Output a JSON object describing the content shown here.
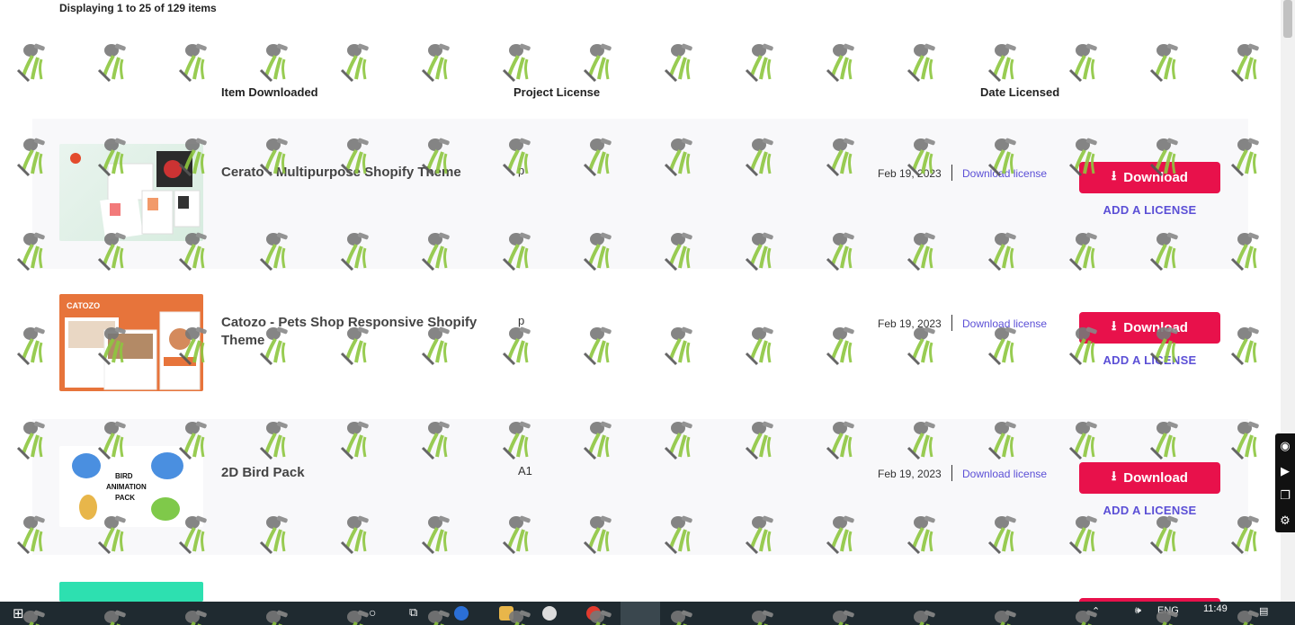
{
  "summary": "Displaying 1 to 25 of 129 items",
  "columns": {
    "item": "Item Downloaded",
    "license": "Project License",
    "date": "Date Licensed"
  },
  "rows": [
    {
      "title": "Cerato - Multipurpose Shopify Theme",
      "license": "p",
      "date": "Feb 19, 2023",
      "download_license": "Download license",
      "download": "Download",
      "add_license": "ADD A LICENSE"
    },
    {
      "title": "Catozo - Pets Shop Responsive Shopify Theme",
      "license": "p",
      "date": "Feb 19, 2023",
      "download_license": "Download license",
      "download": "Download",
      "add_license": "ADD A LICENSE"
    },
    {
      "title": "2D Bird Pack",
      "license": "A1",
      "date": "Feb 19, 2023",
      "download_license": "Download license",
      "download": "Download",
      "add_license": "ADD A LICENSE",
      "thumb_text": "BIRD ANIMATION PACK"
    }
  ],
  "thumb2_logo": "CATOZO",
  "taskbar": {
    "lang": "ENG",
    "time": "11:49"
  },
  "colors": {
    "accent": "#e8114b",
    "link": "#5b4fd6",
    "taskbar": "#1f2a30"
  }
}
